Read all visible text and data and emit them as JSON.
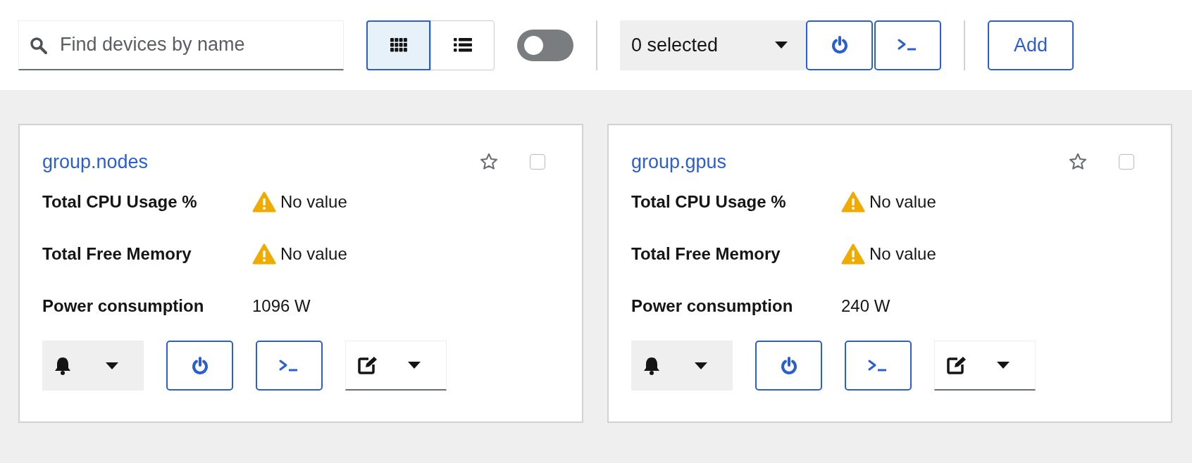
{
  "search": {
    "placeholder": "Find devices by name"
  },
  "view_modes": [
    {
      "kind": "grid",
      "selected": true
    },
    {
      "kind": "list",
      "selected": false
    }
  ],
  "toggle": {
    "on": false
  },
  "bulk_select": {
    "label": "0 selected"
  },
  "add_button": "Add",
  "cards": [
    {
      "title": "group.nodes",
      "favorite": false,
      "checked": false,
      "metrics": [
        {
          "label": "Total CPU Usage %",
          "value": "No value",
          "warning": true
        },
        {
          "label": "Total Free Memory",
          "value": "No value",
          "warning": true
        },
        {
          "label": "Power consumption",
          "value": "1096 W",
          "warning": false
        }
      ]
    },
    {
      "title": "group.gpus",
      "favorite": false,
      "checked": false,
      "metrics": [
        {
          "label": "Total CPU Usage %",
          "value": "No value",
          "warning": true
        },
        {
          "label": "Total Free Memory",
          "value": "No value",
          "warning": true
        },
        {
          "label": "Power consumption",
          "value": "240 W",
          "warning": false
        }
      ]
    }
  ]
}
